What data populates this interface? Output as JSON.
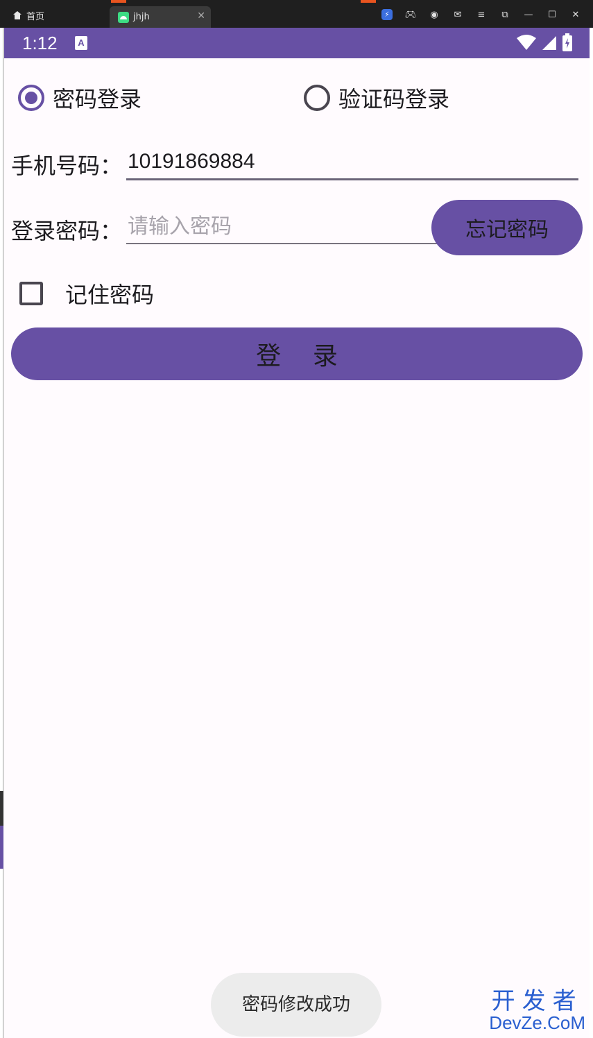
{
  "window": {
    "home_tab_label": "首页",
    "app_tab_label": "jhjh"
  },
  "statusbar": {
    "time": "1:12",
    "indicator_letter": "A"
  },
  "login_mode": {
    "options": [
      {
        "label": "密码登录",
        "selected": true
      },
      {
        "label": "验证码登录",
        "selected": false
      }
    ]
  },
  "phone": {
    "label": "手机号码：",
    "value": "10191869884"
  },
  "password": {
    "label": "登录密码：",
    "placeholder": "请输入密码",
    "value": ""
  },
  "forgot_button": "忘记密码",
  "remember": {
    "label": "记住密码",
    "checked": false
  },
  "login_button": "登    录",
  "toast": "密码修改成功",
  "watermark": {
    "cn": "开发者",
    "en": "DevZe.CoM"
  },
  "colors": {
    "primary": "#6750a4",
    "background": "#fffbfe"
  }
}
